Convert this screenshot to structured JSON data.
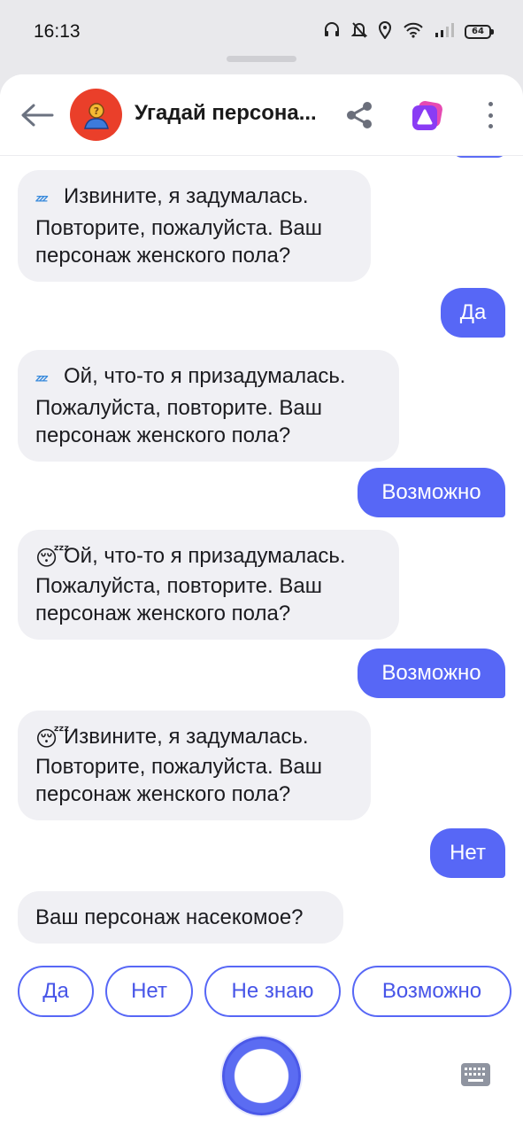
{
  "status_bar": {
    "time": "16:13",
    "battery": "64",
    "icons": [
      "headphones-icon",
      "bell-off-icon",
      "location-icon",
      "wifi-icon",
      "signal-icon",
      "battery-icon"
    ]
  },
  "header": {
    "title": "Угадай персона...",
    "avatar_icon": "person-question-icon",
    "accent_color": "#ea3f2a"
  },
  "messages": [
    {
      "from": "skill",
      "emoji": "zzz",
      "text": "Извините, я задумалась. Повторите, пожалуйста. Ваш персонаж женского пола?"
    },
    {
      "from": "user",
      "text": "Да"
    },
    {
      "from": "skill",
      "emoji": "zzz",
      "text": "Ой, что-то я призадумалась. Пожалуйста, повторите. Ваш персонаж женского пола?"
    },
    {
      "from": "user",
      "text": "Возможно"
    },
    {
      "from": "skill",
      "emoji": "sleepy-face",
      "text": "Ой, что-то я призадумалась. Пожалуйста, повторите. Ваш персонаж женского пола?"
    },
    {
      "from": "user",
      "text": "Возможно"
    },
    {
      "from": "skill",
      "emoji": "sleepy-face",
      "text": "Извините, я задумалась. Повторите, пожалуйста. Ваш персонаж женского пола?"
    },
    {
      "from": "user",
      "text": "Нет"
    },
    {
      "from": "skill",
      "text": "Ваш персонаж насекомое?"
    }
  ],
  "suggestions": [
    "Да",
    "Нет",
    "Не знаю",
    "Возможно"
  ],
  "colors": {
    "user_bubble": "#5767f6",
    "skill_bubble": "#f0f0f4",
    "suggest_border": "#5767f6"
  }
}
